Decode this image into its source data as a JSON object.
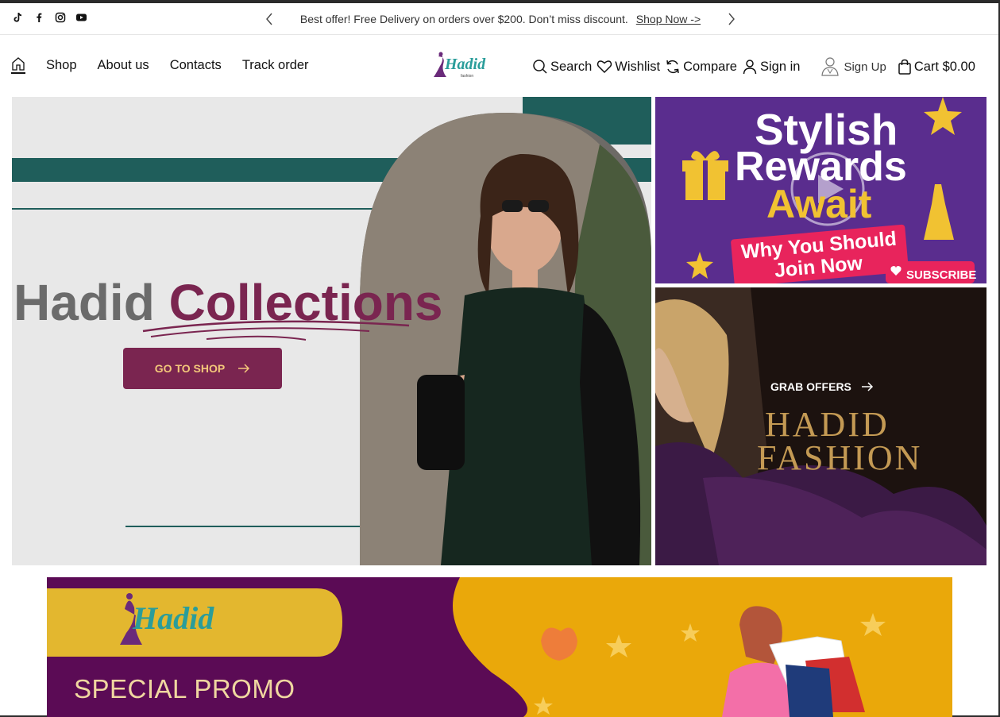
{
  "topbar": {
    "social": [
      "tiktok-icon",
      "facebook-icon",
      "instagram-icon",
      "youtube-icon"
    ],
    "announcement": "Best offer! Free Delivery on orders over $200. Don’t miss discount.",
    "link": "Shop Now ->"
  },
  "nav": {
    "items": [
      "Shop",
      "About us",
      "Contacts",
      "Track order"
    ]
  },
  "actions": {
    "search": "Search",
    "wishlist": "Wishlist",
    "compare": "Compare",
    "signin": "Sign in",
    "signup": "Sign Up",
    "cart": "Cart $0.00"
  },
  "logo": {
    "text": "Hadid"
  },
  "hero": {
    "title_part1": "Hadid",
    "title_part2": "Collections",
    "button": "GO TO SHOP"
  },
  "side1": {
    "line1": "Stylish",
    "line2": "Rewards",
    "line3": "Await",
    "line4": "Why You Should",
    "line5": "Join Now",
    "subscribe": "SUBSCRIBE"
  },
  "side2": {
    "grab": "GRAB OFFERS",
    "brand_line1": "HADID",
    "brand_line2": "FASHION"
  },
  "promo": {
    "logo": "Hadid",
    "title": "SPECIAL PROMO"
  },
  "colors": {
    "accent": "#7a2550",
    "gold": "#f3c77a",
    "purple": "#5a2d8e",
    "teal": "#1f5e5b",
    "promo_yellow": "#eaa80a",
    "promo_purple": "#5b0b55"
  }
}
